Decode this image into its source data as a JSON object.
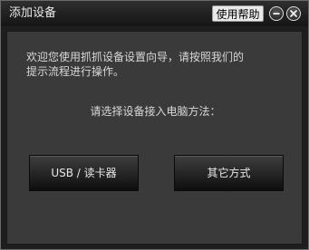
{
  "window": {
    "title": "添加设备",
    "help_label": "使用帮助",
    "minimize_icon": "minimize-icon",
    "close_icon": "close-icon"
  },
  "content": {
    "intro_text": "欢迎您使用抓抓设备设置向导，请按照我们的\n提示流程进行操作。",
    "prompt_text": "请选择设备接入电脑方法：",
    "usb_button_label": "USB / 读卡器",
    "other_button_label": "其它方式"
  }
}
